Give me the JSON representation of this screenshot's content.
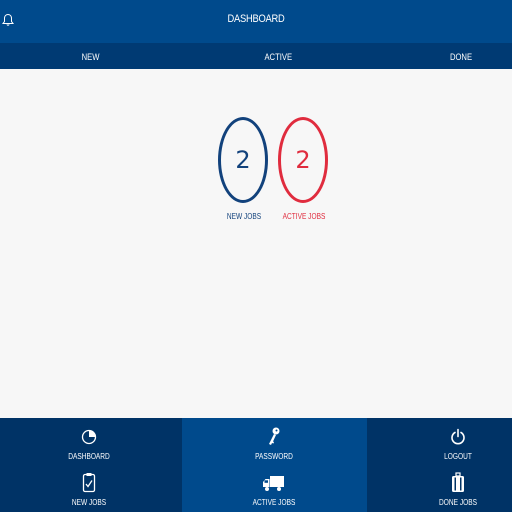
{
  "header": {
    "title": "DASHBOARD",
    "bell_icon": "bell-icon"
  },
  "tabs": [
    {
      "label": "NEW"
    },
    {
      "label": "ACTIVE"
    },
    {
      "label": "DONE"
    }
  ],
  "stats": {
    "new": {
      "count": "2",
      "label": "NEW JOBS",
      "color": "#12427c"
    },
    "active": {
      "count": "2",
      "label": "ACTIVE JOBS",
      "color": "#e02c3e"
    }
  },
  "footer": {
    "dashboard": "DASHBOARD",
    "password": "PASSWORD",
    "logout": "LOGOUT",
    "new_jobs": "NEW JOBS",
    "active_jobs": "ACTIVE JOBS",
    "done_jobs": "DONE JOBS"
  },
  "colors": {
    "primary": "#004a8c",
    "dark": "#003366",
    "accent_red": "#e02c3e"
  }
}
